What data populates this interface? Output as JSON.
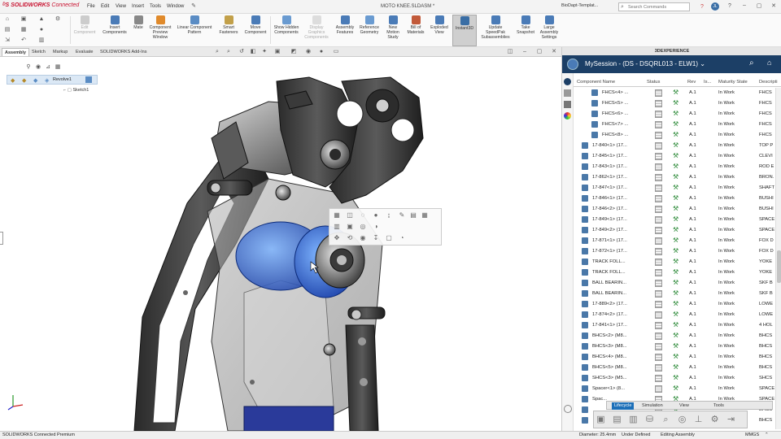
{
  "app": {
    "brand": "SOLIDWORKS",
    "brand_suffix": "Connected",
    "file_title": "MOTO KNEE.SLDASM *",
    "template_field": "BioDapt-Templat...",
    "search_placeholder": "Search Commands"
  },
  "menu": [
    "File",
    "Edit",
    "View",
    "Insert",
    "Tools",
    "Window"
  ],
  "ribbon": [
    {
      "label": "Edit Component",
      "disabled": true,
      "color": "#bbbbbb"
    },
    {
      "label": "Insert Components",
      "disabled": false,
      "color": "#4a7bb7"
    },
    {
      "label": "Mate",
      "disabled": false,
      "color": "#888888"
    },
    {
      "label": "Component Preview Window",
      "disabled": false,
      "color": "#e08a2b"
    },
    {
      "label": "Linear Component Pattern",
      "disabled": false,
      "color": "#5a8cc4"
    },
    {
      "label": "Smart Fasteners",
      "disabled": false,
      "color": "#c2a04a"
    },
    {
      "label": "Move Component",
      "disabled": false,
      "color": "#4a7bb7"
    },
    {
      "label": "Show Hidden Components",
      "disabled": false,
      "color": "#6a9bd1"
    },
    {
      "label": "Display Graphics Components",
      "disabled": true,
      "color": "#cccccc"
    },
    {
      "label": "Assembly Features",
      "disabled": false,
      "color": "#4a7bb7"
    },
    {
      "label": "Reference Geometry",
      "disabled": false,
      "color": "#6a9bd1"
    },
    {
      "label": "New Motion Study",
      "disabled": false,
      "color": "#4a7bb7"
    },
    {
      "label": "Bill of Materials",
      "disabled": false,
      "color": "#c25a3a"
    },
    {
      "label": "Exploded View",
      "disabled": false,
      "color": "#4a7bb7"
    },
    {
      "label": "Instant3D",
      "disabled": false,
      "active": true,
      "color": "#3a6ea5"
    },
    {
      "label": "Update SpeedPak Subassemblies",
      "disabled": false,
      "color": "#4a7bb7"
    },
    {
      "label": "Take Snapshot",
      "disabled": false,
      "color": "#4a7bb7"
    },
    {
      "label": "Large Assembly Settings",
      "disabled": false,
      "color": "#4a7bb7"
    }
  ],
  "command_tabs": [
    "Assembly",
    "Sketch",
    "Markup",
    "Evaluate",
    "SOLIDWORKS Add-Ins"
  ],
  "feature_tree": {
    "root": "Revolve1",
    "child": "Sketch1"
  },
  "panel": {
    "title": "3DEXPERIENCE",
    "session": "MySession - (DS - DSQRL013 - ELW1)",
    "columns": [
      "Component Name",
      "Status",
      "Rev",
      "Is...",
      "Maturity State",
      "Descripti"
    ],
    "rows": [
      {
        "indent": 2,
        "name": "FHCS<4> ...",
        "rev": "A.1",
        "state": "In Work",
        "desc": "FHCS"
      },
      {
        "indent": 2,
        "name": "FHCS<5> ...",
        "rev": "A.1",
        "state": "In Work",
        "desc": "FHCS"
      },
      {
        "indent": 2,
        "name": "FHCS<6> ...",
        "rev": "A.1",
        "state": "In Work",
        "desc": "FHCS"
      },
      {
        "indent": 2,
        "name": "FHCS<7> ...",
        "rev": "A.1",
        "state": "In Work",
        "desc": "FHCS"
      },
      {
        "indent": 2,
        "name": "FHCS<8> ...",
        "rev": "A.1",
        "state": "In Work",
        "desc": "FHCS"
      },
      {
        "indent": 1,
        "name": "17-840<1> (17...",
        "rev": "A.1",
        "state": "In Work",
        "desc": "TOP P"
      },
      {
        "indent": 1,
        "name": "17-845<1> (17...",
        "rev": "A.1",
        "state": "In Work",
        "desc": "CLEVI"
      },
      {
        "indent": 1,
        "name": "17-843<1> (17...",
        "rev": "A.1",
        "state": "In Work",
        "desc": "ROD E"
      },
      {
        "indent": 1,
        "name": "17-862<1> (17...",
        "rev": "A.1",
        "state": "In Work",
        "desc": "BRON."
      },
      {
        "indent": 1,
        "name": "17-847<1> (17...",
        "rev": "A.1",
        "state": "In Work",
        "desc": "SHAFT"
      },
      {
        "indent": 1,
        "name": "17-846<1> (17...",
        "rev": "A.1",
        "state": "In Work",
        "desc": "BUSHI"
      },
      {
        "indent": 1,
        "name": "17-846<2> (17...",
        "rev": "A.1",
        "state": "In Work",
        "desc": "BUSHI"
      },
      {
        "indent": 1,
        "name": "17-849<1> (17...",
        "rev": "A.1",
        "state": "In Work",
        "desc": "SPACE"
      },
      {
        "indent": 1,
        "name": "17-849<2> (17...",
        "rev": "A.1",
        "state": "In Work",
        "desc": "SPACE"
      },
      {
        "indent": 1,
        "name": "17-871<1> (17...",
        "rev": "A.1",
        "state": "In Work",
        "desc": "FOX D"
      },
      {
        "indent": 1,
        "name": "17-872<1> (17...",
        "rev": "A.1",
        "state": "In Work",
        "desc": "FOX D"
      },
      {
        "indent": 1,
        "name": "TRACK FOLL...",
        "rev": "A.1",
        "state": "In Work",
        "desc": "YOKE"
      },
      {
        "indent": 1,
        "name": "TRACK FOLL...",
        "rev": "A.1",
        "state": "In Work",
        "desc": "YOKE"
      },
      {
        "indent": 1,
        "name": "BALL BEARIN...",
        "rev": "A.1",
        "state": "In Work",
        "desc": "SKF B"
      },
      {
        "indent": 1,
        "name": "BALL BEARIN...",
        "rev": "A.1",
        "state": "In Work",
        "desc": "SKF B"
      },
      {
        "indent": 1,
        "name": "17-889<2> (17...",
        "rev": "A.1",
        "state": "In Work",
        "desc": "LOWE"
      },
      {
        "indent": 1,
        "name": "17-874<2> (17...",
        "rev": "A.1",
        "state": "In Work",
        "desc": "LOWE"
      },
      {
        "indent": 1,
        "name": "17-841<1> (17...",
        "rev": "A.1",
        "state": "In Work",
        "desc": "4 HOL"
      },
      {
        "indent": 1,
        "name": "BHCS<2> (M8...",
        "rev": "A.1",
        "state": "In Work",
        "desc": "BHCS"
      },
      {
        "indent": 1,
        "name": "BHCS<3> (M8...",
        "rev": "A.1",
        "state": "In Work",
        "desc": "BHCS"
      },
      {
        "indent": 1,
        "name": "BHCS<4> (M8...",
        "rev": "A.1",
        "state": "In Work",
        "desc": "BHCS"
      },
      {
        "indent": 1,
        "name": "BHCS<5> (M8...",
        "rev": "A.1",
        "state": "In Work",
        "desc": "BHCS"
      },
      {
        "indent": 1,
        "name": "SHCS<3> (M5...",
        "rev": "A.1",
        "state": "In Work",
        "desc": "SHCS"
      },
      {
        "indent": 1,
        "name": "Spacer<1> (8...",
        "rev": "A.1",
        "state": "In Work",
        "desc": "SPACE"
      },
      {
        "indent": 1,
        "name": "Spac...",
        "rev": "A.1",
        "state": "In Work",
        "desc": "SPACE"
      },
      {
        "indent": 1,
        "name": "",
        "rev": "",
        "state": "",
        "desc": "BHCS"
      },
      {
        "indent": 1,
        "name": "",
        "rev": "",
        "state": "",
        "desc": "BHCS"
      }
    ],
    "bottom_tabs": [
      "Lifecycle",
      "Simulation",
      "View",
      "Tools"
    ]
  },
  "status": {
    "product": "SOLIDWORKS Connected Premium",
    "diameter": "Diameter: 25.4mm",
    "definition": "Under Defined",
    "mode": "Editing Assembly",
    "units": "MMGS"
  }
}
